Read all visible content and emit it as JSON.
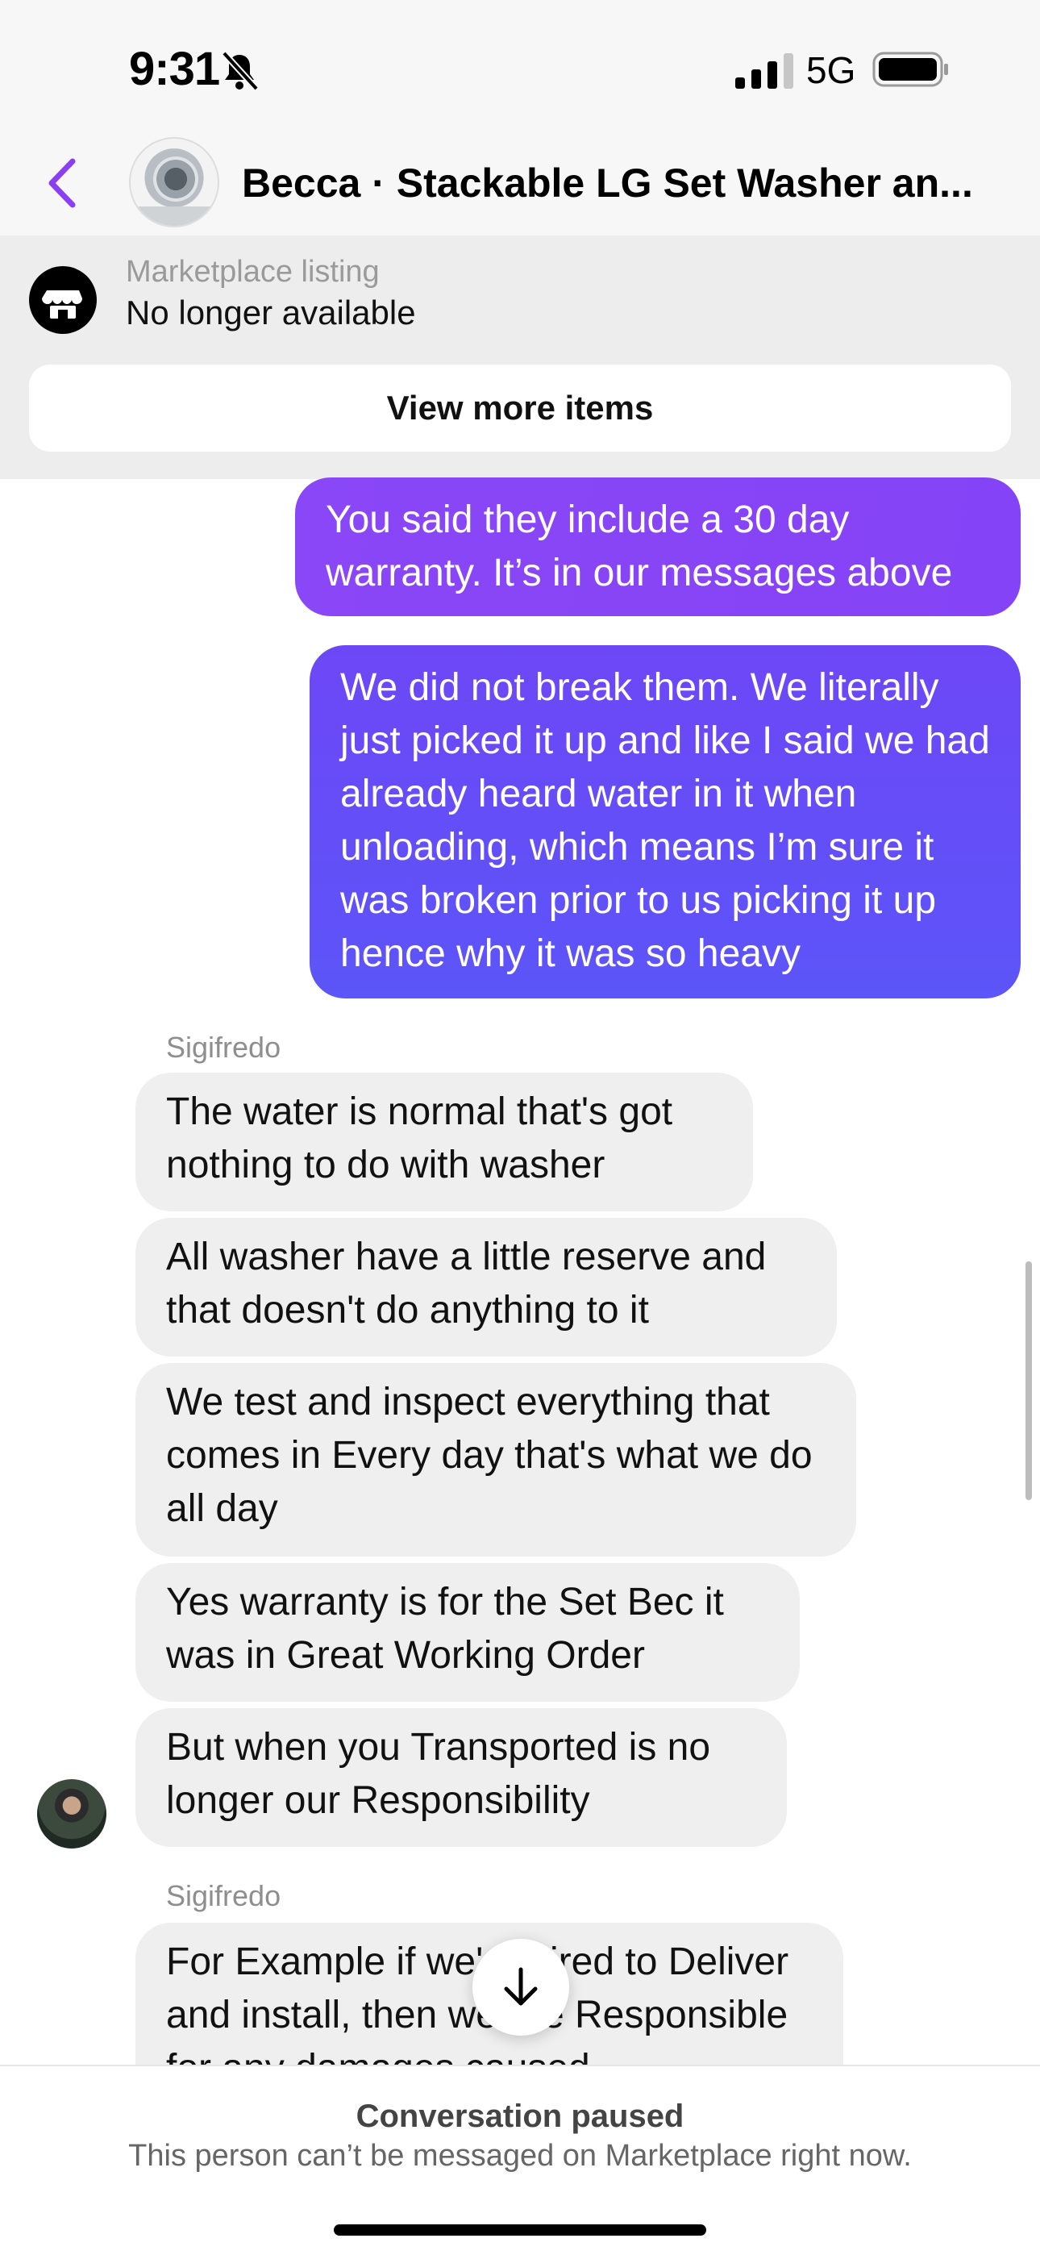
{
  "status_bar": {
    "time": "9:31",
    "network": "5G",
    "icons": [
      "bell-slash-icon",
      "signal-icon",
      "battery-icon"
    ]
  },
  "header": {
    "title": "Becca · Stackable LG Set Washer an...",
    "back_icon": "chevron-left-icon"
  },
  "listing": {
    "label": "Marketplace listing",
    "status": "No longer available",
    "button": "View more items",
    "icon": "storefront-icon"
  },
  "messages": {
    "outgoing": [
      "You said they include a 30 day warranty. It’s in our messages above",
      "We did not break them. We literally just picked it up and like I said we had already heard water in it when unloading, which means I’m sure it was broken prior to us picking it up hence why it was so heavy"
    ],
    "sender_name": "Sigifredo",
    "incoming": [
      "The water is normal that's got nothing to do with washer",
      "All washer have a little reserve and that doesn't do anything to it",
      "We test and inspect everything that comes in Every day that's what we do all day",
      "Yes warranty is for the Set Bec it was in Great Working Order",
      "But when you Transported is no longer our Responsibility"
    ],
    "incoming_2_sender": "Sigifredo",
    "incoming_2": "For Example if we're hired to Deliver and install, then we are Responsible for any damages caused"
  },
  "footer": {
    "title": "Conversation paused",
    "subtitle": "This person can’t be messaged on Marketplace right now."
  },
  "colors": {
    "outgoing_top": "#8a47f7",
    "outgoing_bottom": "#5c55f8",
    "incoming": "#efefef",
    "accent": "#8a3ff5"
  }
}
